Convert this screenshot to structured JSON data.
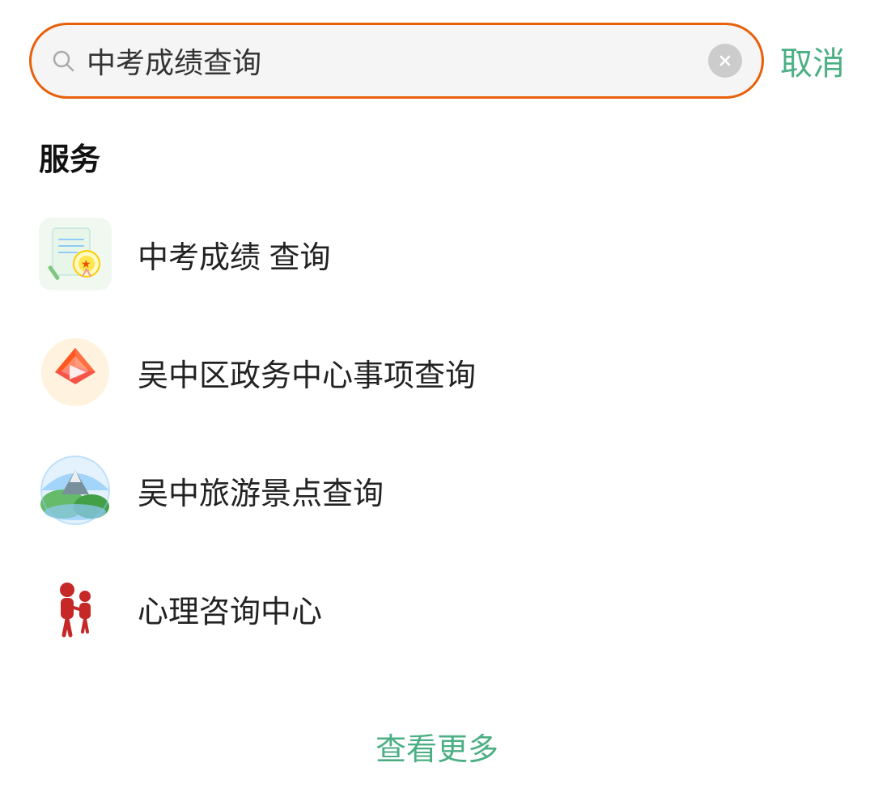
{
  "search": {
    "value": "中考成绩查询",
    "placeholder": "中考成绩查询",
    "cancel_label": "取消"
  },
  "section": {
    "title": "服务"
  },
  "services": [
    {
      "id": "zhongkao",
      "label": "中考成绩 查询",
      "icon_type": "zhongkao"
    },
    {
      "id": "wuzhong-gov",
      "label": "吴中区政务中心事项查询",
      "icon_type": "gov"
    },
    {
      "id": "wuzhong-tour",
      "label": "吴中旅游景点查询",
      "icon_type": "tour"
    },
    {
      "id": "xinli",
      "label": "心理咨询中心",
      "icon_type": "xinli"
    }
  ],
  "see_more": {
    "label": "查看更多"
  },
  "colors": {
    "accent": "#4caf84",
    "search_border": "#e8600a",
    "text_primary": "#222",
    "text_secondary": "#aaa"
  }
}
